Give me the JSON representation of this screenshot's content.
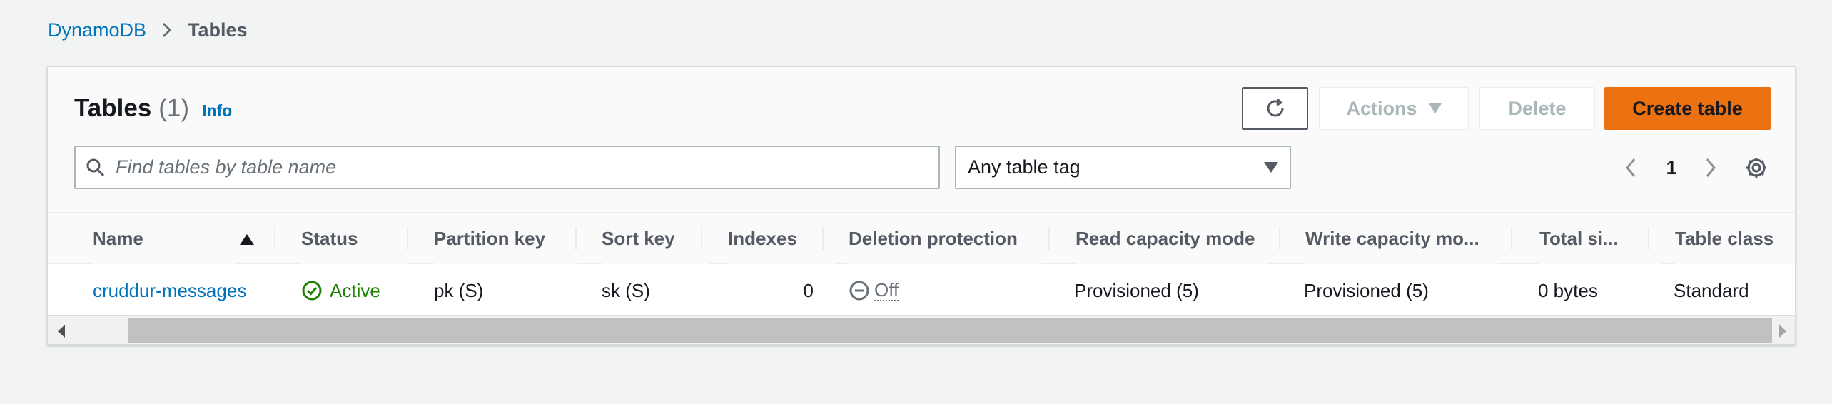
{
  "breadcrumb": {
    "root": "DynamoDB",
    "current": "Tables"
  },
  "header": {
    "title": "Tables",
    "count": "(1)",
    "info": "Info"
  },
  "toolbar": {
    "refresh_icon": "refresh-icon",
    "actions_label": "Actions",
    "delete_label": "Delete",
    "create_label": "Create table",
    "primary_color": "#ec7211",
    "link_color": "#0073bb"
  },
  "filter": {
    "search_placeholder": "Find tables by table name",
    "search_value": "",
    "tag_select": "Any table tag"
  },
  "pagination": {
    "page": "1"
  },
  "table": {
    "columns": [
      "Name",
      "Status",
      "Partition key",
      "Sort key",
      "Indexes",
      "Deletion protection",
      "Read capacity mode",
      "Write capacity mo...",
      "Total si...",
      "Table class"
    ],
    "rows": [
      {
        "name": "cruddur-messages",
        "status": "Active",
        "partition_key": "pk (S)",
        "sort_key": "sk (S)",
        "indexes": "0",
        "deletion_protection": "Off",
        "read_capacity": "Provisioned (5)",
        "write_capacity": "Provisioned (5)",
        "total_size": "0 bytes",
        "table_class": "Standard"
      }
    ],
    "status_color": "#1d8102"
  }
}
